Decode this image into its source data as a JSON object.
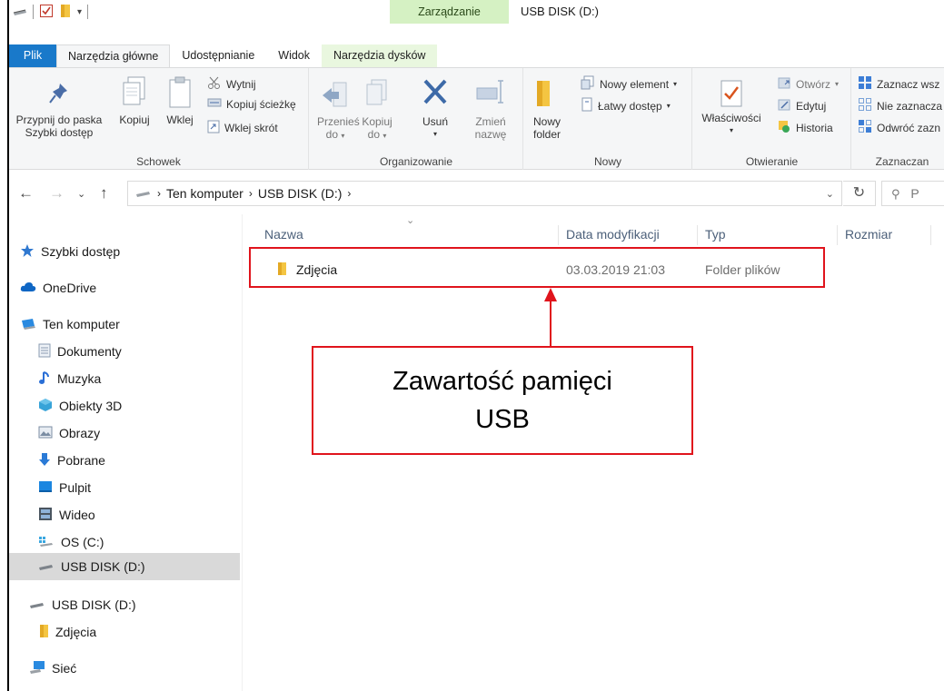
{
  "window": {
    "title": "USB DISK (D:)",
    "context_group": "Zarządzanie"
  },
  "tabs": [
    {
      "label": "Plik"
    },
    {
      "label": "Narzędzia główne"
    },
    {
      "label": "Udostępnianie"
    },
    {
      "label": "Widok"
    },
    {
      "label": "Narzędzia dysków"
    }
  ],
  "ribbon": {
    "clipboard": {
      "group_label": "Schowek",
      "pin_label_1": "Przypnij do paska",
      "pin_label_2": "Szybki dostęp",
      "copy": "Kopiuj",
      "paste": "Wklej",
      "cut": "Wytnij",
      "copy_path": "Kopiuj ścieżkę",
      "paste_shortcut": "Wklej skrót"
    },
    "organize": {
      "group_label": "Organizowanie",
      "move_1": "Przenieś",
      "move_2": "do",
      "copy_1": "Kopiuj",
      "copy_2": "do",
      "delete": "Usuń",
      "rename_1": "Zmień",
      "rename_2": "nazwę"
    },
    "new": {
      "group_label": "Nowy",
      "new_folder_1": "Nowy",
      "new_folder_2": "folder",
      "new_item": "Nowy element",
      "easy_access": "Łatwy dostęp"
    },
    "open": {
      "group_label": "Otwieranie",
      "properties": "Właściwości",
      "open": "Otwórz",
      "edit": "Edytuj",
      "history": "Historia"
    },
    "select": {
      "group_label": "Zaznaczan",
      "select_all": "Zaznacz wsz",
      "select_none": "Nie zaznacza",
      "invert": "Odwróć zazn"
    }
  },
  "address": {
    "crumbs": [
      "Ten komputer",
      "USB DISK (D:)"
    ],
    "search_placeholder": "P"
  },
  "nav": [
    {
      "label": "Szybki dostęp",
      "icon": "star-icon"
    },
    {
      "label": "OneDrive",
      "icon": "cloud-icon"
    },
    {
      "label": "Ten komputer",
      "icon": "computer-icon"
    },
    {
      "label": "Dokumenty",
      "icon": "document-icon"
    },
    {
      "label": "Muzyka",
      "icon": "music-icon"
    },
    {
      "label": "Obiekty 3D",
      "icon": "cube-icon"
    },
    {
      "label": "Obrazy",
      "icon": "image-icon"
    },
    {
      "label": "Pobrane",
      "icon": "download-icon"
    },
    {
      "label": "Pulpit",
      "icon": "desktop-icon"
    },
    {
      "label": "Wideo",
      "icon": "video-icon"
    },
    {
      "label": "OS (C:)",
      "icon": "drive-icon"
    },
    {
      "label": "USB DISK (D:)",
      "icon": "usb-drive-icon",
      "selected": true
    },
    {
      "label": "USB DISK (D:)",
      "icon": "usb-drive-icon"
    },
    {
      "label": "Zdjęcia",
      "icon": "folder-icon"
    },
    {
      "label": "Sieć",
      "icon": "network-icon"
    }
  ],
  "columns": {
    "name": "Nazwa",
    "date": "Data modyfikacji",
    "type": "Typ",
    "size": "Rozmiar"
  },
  "files": [
    {
      "name": "Zdjęcia",
      "date": "03.03.2019 21:03",
      "type": "Folder plików",
      "size": ""
    }
  ],
  "annotation": {
    "line1": "Zawartość pamięci",
    "line2": "USB",
    "color": "#e0141c"
  }
}
